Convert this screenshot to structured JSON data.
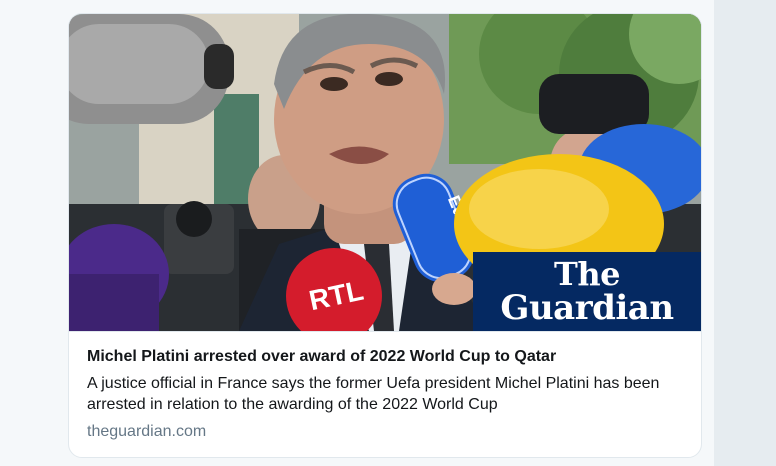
{
  "card": {
    "title": "Michel Platini arrested over award of 2022 World Cup to Qatar",
    "description": "A justice official in France says the former Uefa president Michel Platini has been arrested in relation to the awarding of the 2022 World Cup",
    "domain": "theguardian.com"
  },
  "image": {
    "logo_line1": "The",
    "logo_line2": "Guardian",
    "mic_rtl": "RTL",
    "mic_europe1": "Europe 1"
  },
  "colors": {
    "guardian_navy": "#052962",
    "rtl_red": "#d41c2c",
    "mic_yellow": "#f3c516",
    "mic_blue": "#1f5fd6",
    "mic_purple": "#4b2a8a"
  }
}
